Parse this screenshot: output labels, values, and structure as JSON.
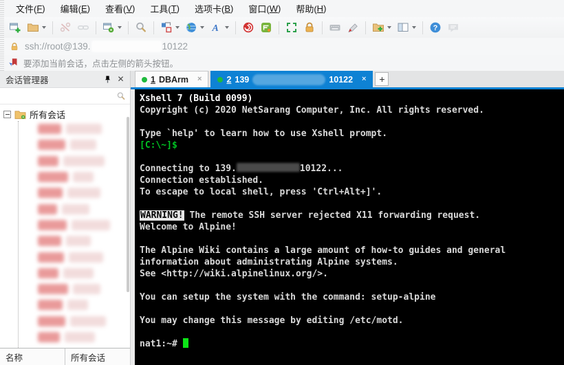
{
  "menu_bar": {
    "items": [
      "文件(F)",
      "编辑(E)",
      "查看(V)",
      "工具(T)",
      "选项卡(B)",
      "窗口(W)",
      "帮助(H)"
    ]
  },
  "toolbar": {
    "buttons": [
      {
        "name": "new-session-button",
        "icon": "new-session-icon"
      },
      {
        "name": "open-button",
        "icon": "open-folder-icon",
        "dropdown": true
      },
      {
        "sep": true
      },
      {
        "name": "disconnect-button",
        "icon": "disconnect-icon",
        "disabled": true
      },
      {
        "name": "reconnect-button",
        "icon": "reconnect-icon",
        "disabled": true
      },
      {
        "sep": true
      },
      {
        "name": "properties-button",
        "icon": "properties-icon",
        "dropdown": true
      },
      {
        "sep": true
      },
      {
        "name": "find-button",
        "icon": "find-icon"
      },
      {
        "sep": true
      },
      {
        "name": "compose-button",
        "icon": "compose-icon",
        "dropdown": true
      },
      {
        "name": "encoding-button",
        "icon": "globe-icon",
        "dropdown": true
      },
      {
        "name": "font-button",
        "icon": "font-icon",
        "dropdown": true
      },
      {
        "sep": true
      },
      {
        "name": "xagent-button",
        "icon": "xagent-icon"
      },
      {
        "name": "xftp-button",
        "icon": "xftp-icon"
      },
      {
        "sep": true
      },
      {
        "name": "fullscreen-button",
        "icon": "fullscreen-icon"
      },
      {
        "name": "lock-button",
        "icon": "lock-icon"
      },
      {
        "sep": true
      },
      {
        "name": "keyboard-button",
        "icon": "keyboard-icon"
      },
      {
        "name": "highlight-button",
        "icon": "highlight-icon"
      },
      {
        "sep": true
      },
      {
        "name": "new-folder-button",
        "icon": "folder-plus-icon",
        "dropdown": true
      },
      {
        "name": "layout-button",
        "icon": "layout-icon",
        "dropdown": true
      },
      {
        "sep": true
      },
      {
        "name": "help-button",
        "icon": "help-icon"
      },
      {
        "name": "feedback-button",
        "icon": "feedback-icon",
        "disabled": true
      }
    ]
  },
  "address_bar": {
    "prefix": "ssh://root@139.",
    "suffix": "10122",
    "redacted": true
  },
  "info_bar": {
    "text": "要添加当前会话，点击左侧的箭头按钮。"
  },
  "session_manager": {
    "title": "会话管理器",
    "search_placeholder": "",
    "root_node": "所有会话",
    "redacted_session_count": 14,
    "footer_columns": [
      "名称",
      "所有会话"
    ]
  },
  "tabs": {
    "new_tab_label": "+",
    "items": [
      {
        "number": "1",
        "parts": [
          {
            "text": "DBArm"
          }
        ],
        "active": false,
        "close": "×"
      },
      {
        "number": "2",
        "parts": [
          {
            "text": "139"
          },
          {
            "redact": true
          },
          {
            "text": "10122"
          }
        ],
        "active": true,
        "close": "×"
      }
    ]
  },
  "terminal": {
    "lines": [
      [
        {
          "t": "Xshell 7 (Build 0099)",
          "s": "bright"
        }
      ],
      [
        {
          "t": "Copyright (c) 2020 NetSarang Computer, Inc. All rights reserved.",
          "s": "plain"
        }
      ],
      [],
      [
        {
          "t": "Type `help' to learn how to use Xshell prompt.",
          "s": "plain"
        }
      ],
      [
        {
          "t": "[C:\\~]$",
          "s": "green"
        }
      ],
      [],
      [
        {
          "t": "Connecting to 139.",
          "s": "plain"
        },
        {
          "redact": true
        },
        {
          "t": "10122...",
          "s": "plain"
        }
      ],
      [
        {
          "t": "Connection established.",
          "s": "plain"
        }
      ],
      [
        {
          "t": "To escape to local shell, press 'Ctrl+Alt+]'.",
          "s": "plain"
        }
      ],
      [],
      [
        {
          "t": "WARNING!",
          "s": "inverse"
        },
        {
          "t": " The remote SSH server rejected X11 forwarding request.",
          "s": "plain"
        }
      ],
      [
        {
          "t": "Welcome to Alpine!",
          "s": "plain"
        }
      ],
      [],
      [
        {
          "t": "The Alpine Wiki contains a large amount of how-to guides and general",
          "s": "plain"
        }
      ],
      [
        {
          "t": "information about administrating Alpine systems.",
          "s": "plain"
        }
      ],
      [
        {
          "t": "See <http://wiki.alpinelinux.org/>.",
          "s": "plain"
        }
      ],
      [],
      [
        {
          "t": "You can setup the system with the command: setup-alpine",
          "s": "plain"
        }
      ],
      [],
      [
        {
          "t": "You may change this message by editing /etc/motd.",
          "s": "plain"
        }
      ],
      [],
      [
        {
          "t": "nat1:~# ",
          "s": "plain"
        },
        {
          "cursor": true
        }
      ]
    ]
  },
  "colors": {
    "active_tab_blue": "#0e82d4",
    "terminal_green": "#00c322",
    "cursor_green": "#0ce516",
    "connected_dot_green": "#1fba3d",
    "terminal_bg": "#000000"
  }
}
